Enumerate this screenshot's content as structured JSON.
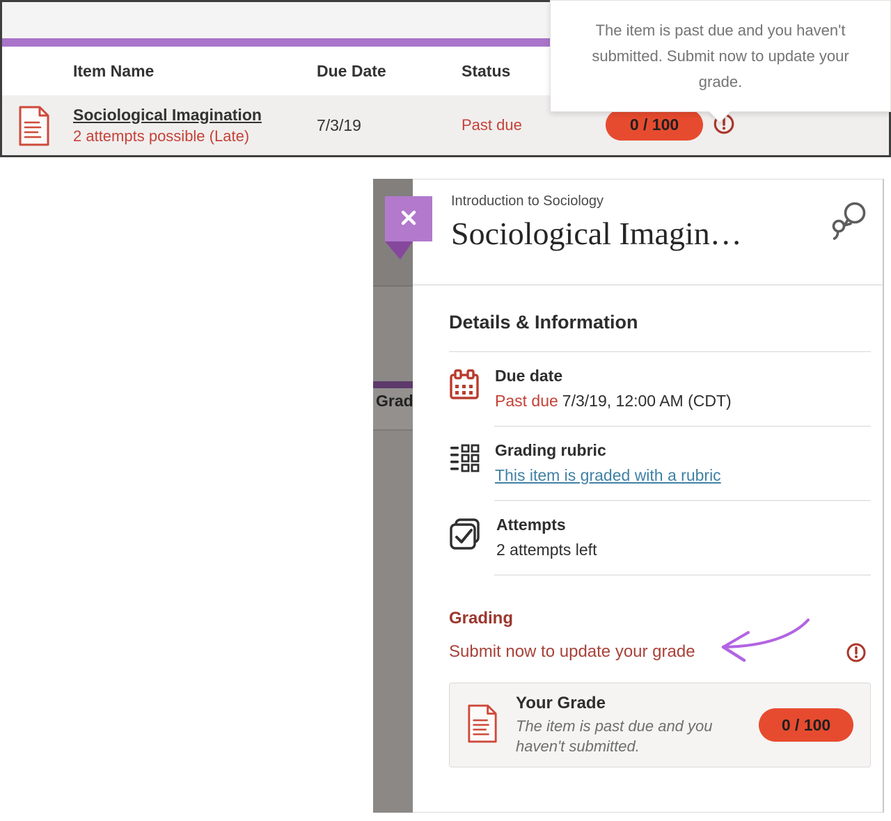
{
  "table": {
    "columns": [
      "Item Name",
      "Due Date",
      "Status"
    ],
    "row": {
      "name": "Sociological Imagination",
      "subtitle": "2 attempts possible (Late)",
      "due_date": "7/3/19",
      "status": "Past due",
      "grade_pill": "0 / 100"
    }
  },
  "tooltip": {
    "text": "The item is past due and you haven't submitted. Submit now to update your grade."
  },
  "background_strip": {
    "label": "Grad"
  },
  "panel": {
    "course": "Introduction to Sociology",
    "title": "Sociological Imagin…",
    "details_heading": "Details & Information",
    "due": {
      "label": "Due date",
      "status": "Past due",
      "value": "7/3/19, 12:00 AM (CDT)"
    },
    "rubric": {
      "label": "Grading rubric",
      "link": "This item is graded with a rubric"
    },
    "attempts": {
      "label": "Attempts",
      "value": "2 attempts left"
    },
    "grading": {
      "heading": "Grading",
      "message": "Submit now to update your grade",
      "card": {
        "title": "Your Grade",
        "description": "The item is past due and you haven't submitted.",
        "pill": "0 / 100"
      }
    }
  },
  "colors": {
    "accent_purple": "#a974c9",
    "ribbon_purple": "#b279cc",
    "ribbon_fold": "#86489c",
    "dim_purple": "#5d3a6b",
    "alert_red": "#c64137",
    "pill_red": "#e74b2f",
    "pill_text": "#1f1f1f",
    "icon_red": "#cd4a3a",
    "calendar_red": "#b93c2e",
    "exclaim_red": "#ab372c",
    "link_blue": "#4181a5",
    "grading_red": "#9c372e",
    "message_red": "#a8423a",
    "arrow_purple": "#b264e3"
  }
}
